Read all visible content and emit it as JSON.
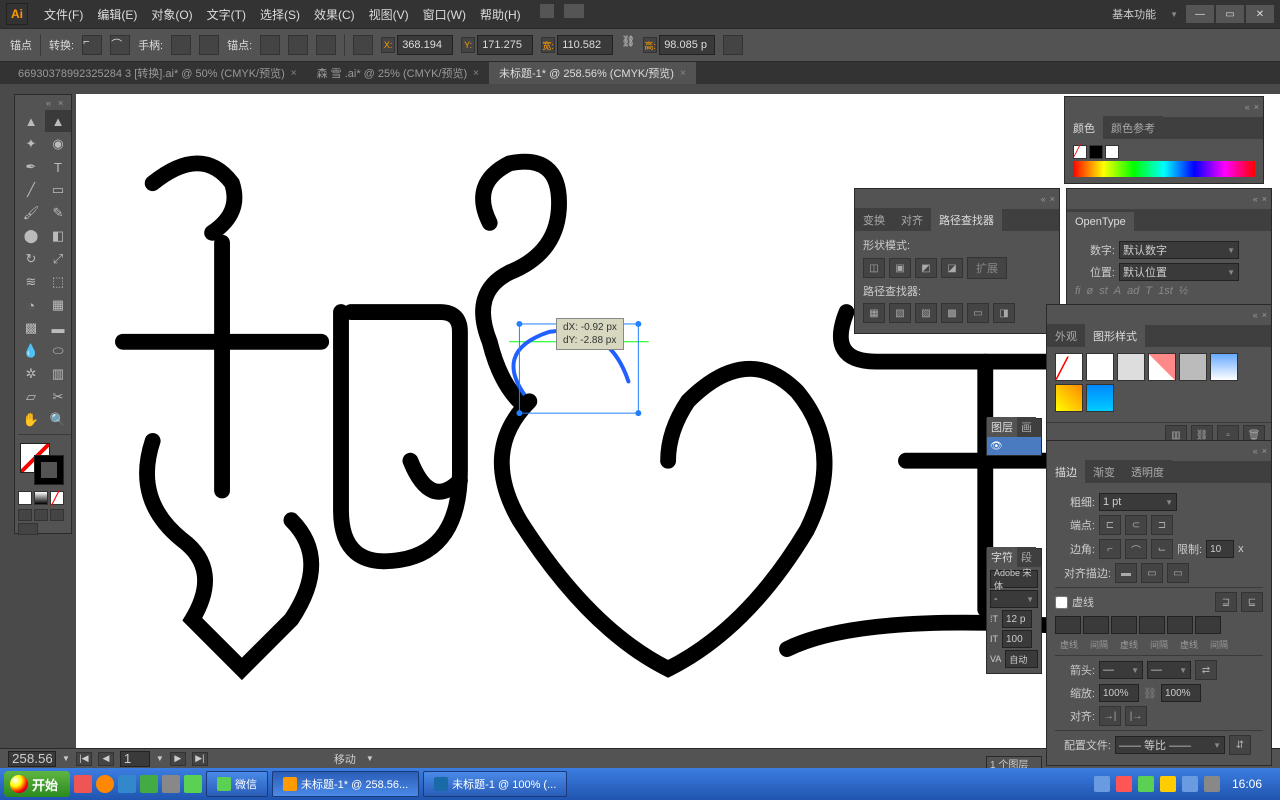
{
  "titlebar": {
    "logo": "Ai",
    "workspace": "基本功能"
  },
  "menus": [
    "文件(F)",
    "编辑(E)",
    "对象(O)",
    "文字(T)",
    "选择(S)",
    "效果(C)",
    "视图(V)",
    "窗口(W)",
    "帮助(H)"
  ],
  "controlbar": {
    "anchor": "锚点",
    "convert": "转换:",
    "handle": "手柄:",
    "anchors": "锚点:",
    "x": "X:",
    "x_val": "368.194",
    "y": "Y:",
    "y_val": "171.275",
    "w": "宽:",
    "w_val": "110.582",
    "h": "高:",
    "h_val": "98.085 p"
  },
  "tabs": [
    {
      "label": "66930378992325284 3 [转换].ai* @ 50% (CMYK/预览)",
      "active": false
    },
    {
      "label": "森 雪 .ai* @ 25% (CMYK/预览)",
      "active": false
    },
    {
      "label": "未标题-1* @ 258.56% (CMYK/预览)",
      "active": true
    }
  ],
  "tooltip": {
    "dx": "dX: -0.92 px",
    "dy": "dY: -2.88 px"
  },
  "canvas_status": {
    "zoom": "258.56",
    "page": "1",
    "mode": "移动"
  },
  "color_panel": {
    "tabs": [
      "颜色",
      "颜色参考"
    ]
  },
  "pathfinder_panel": {
    "tabs": [
      "变换",
      "对齐",
      "路径查找器"
    ],
    "shape_mode": "形状模式:",
    "expand": "扩展",
    "pathfinder": "路径查找器:"
  },
  "opentype_panel": {
    "tab": "OpenType",
    "number_label": "数字:",
    "number_val": "默认数字",
    "position_label": "位置:",
    "position_val": "默认位置"
  },
  "appearance_panel": {
    "tabs": [
      "外观",
      "图形样式"
    ]
  },
  "layers_panel": {
    "tabs": [
      "图层",
      "画"
    ],
    "footer": "1 个图层"
  },
  "stroke_panel": {
    "tabs": [
      "描边",
      "渐变",
      "透明度"
    ],
    "weight": "粗细:",
    "weight_val": "1 pt",
    "cap": "端点:",
    "corner": "边角:",
    "limit": "限制:",
    "limit_val": "10",
    "limit_unit": "x",
    "align": "对齐描边:",
    "dash": "虚线",
    "dash_labels": [
      "虚线",
      "间隔",
      "虚线",
      "间隔",
      "虚线",
      "间隔"
    ],
    "arrow": "箭头:",
    "scale": "缩放:",
    "scale_val1": "100%",
    "scale_val2": "100%",
    "align2": "对齐:",
    "profile": "配置文件:",
    "profile_val": "—— 等比 ——"
  },
  "char_panel": {
    "tabs": [
      "字符",
      "段"
    ],
    "font": "Adobe 宋体",
    "size": "12 p",
    "leading": "100",
    "tracking": "自动"
  },
  "taskbar": {
    "start": "开始",
    "items": [
      {
        "icon": "wechat",
        "label": "微信"
      },
      {
        "icon": "ai",
        "label": "未标题-1* @ 258.56..."
      },
      {
        "icon": "ps",
        "label": "未标题-1 @ 100% (..."
      }
    ],
    "clock": "16:06"
  }
}
